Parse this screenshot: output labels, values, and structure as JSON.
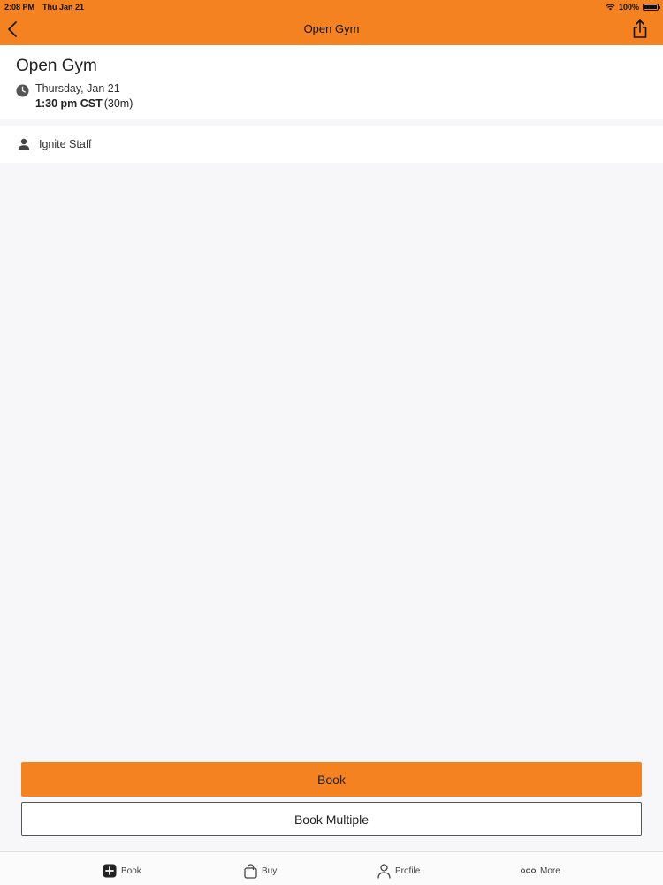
{
  "status_bar": {
    "time": "2:08 PM",
    "date": "Thu Jan 21",
    "battery": "100%"
  },
  "nav": {
    "title": "Open Gym"
  },
  "event": {
    "title": "Open Gym",
    "date": "Thursday, Jan 21",
    "time": "1:30 pm CST",
    "duration": "(30m)",
    "staff": "Ignite Staff"
  },
  "actions": {
    "book_label": "Book",
    "book_multiple_label": "Book Multiple"
  },
  "tabs": [
    {
      "label": "Book",
      "icon": "plus-square-icon"
    },
    {
      "label": "Buy",
      "icon": "shopping-bag-icon"
    },
    {
      "label": "Profile",
      "icon": "person-icon"
    },
    {
      "label": "More",
      "icon": "ellipsis-icon"
    }
  ],
  "colors": {
    "accent": "#f58220",
    "background": "#f7f7f9"
  }
}
